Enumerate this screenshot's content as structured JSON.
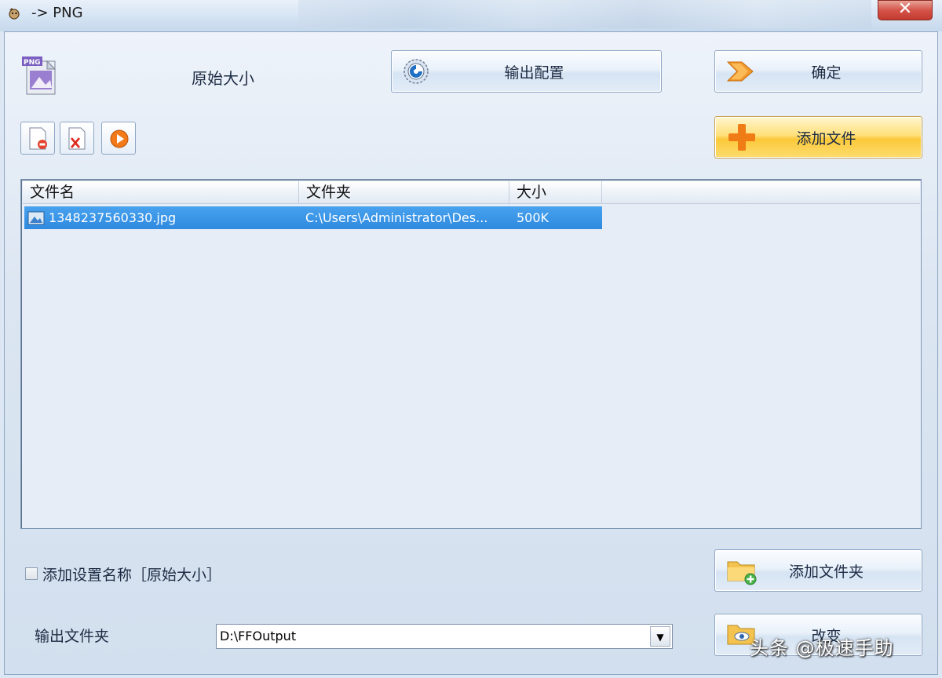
{
  "window": {
    "title": "-> PNG",
    "close_glyph": "✕"
  },
  "header": {
    "format_label": "原始大小",
    "output_config_label": "输出配置",
    "ok_label": "确定",
    "add_file_label": "添加文件",
    "format_icon_text": "PNG"
  },
  "toolbar": {
    "icons": [
      "remove-file-icon",
      "clear-list-icon",
      "play-icon"
    ]
  },
  "list": {
    "columns": [
      "文件名",
      "文件夹",
      "大小"
    ],
    "rows": [
      {
        "name": "1348237560330.jpg",
        "folder": "C:\\Users\\Administrator\\Des...",
        "size": "500K",
        "selected": true
      }
    ]
  },
  "bottom": {
    "append_name_label": "添加设置名称［原始大小］",
    "append_name_checked": false,
    "add_folder_label": "添加文件夹",
    "output_folder_label": "输出文件夹",
    "output_folder_value": "D:\\FFOutput",
    "change_label": "改变"
  },
  "watermark": "头条 @极速手助",
  "colors": {
    "selection": "#2f8ae0",
    "accent_orange": "#f08a1c",
    "add_file_button": "#fbc93a",
    "close_button": "#c23a2f"
  }
}
